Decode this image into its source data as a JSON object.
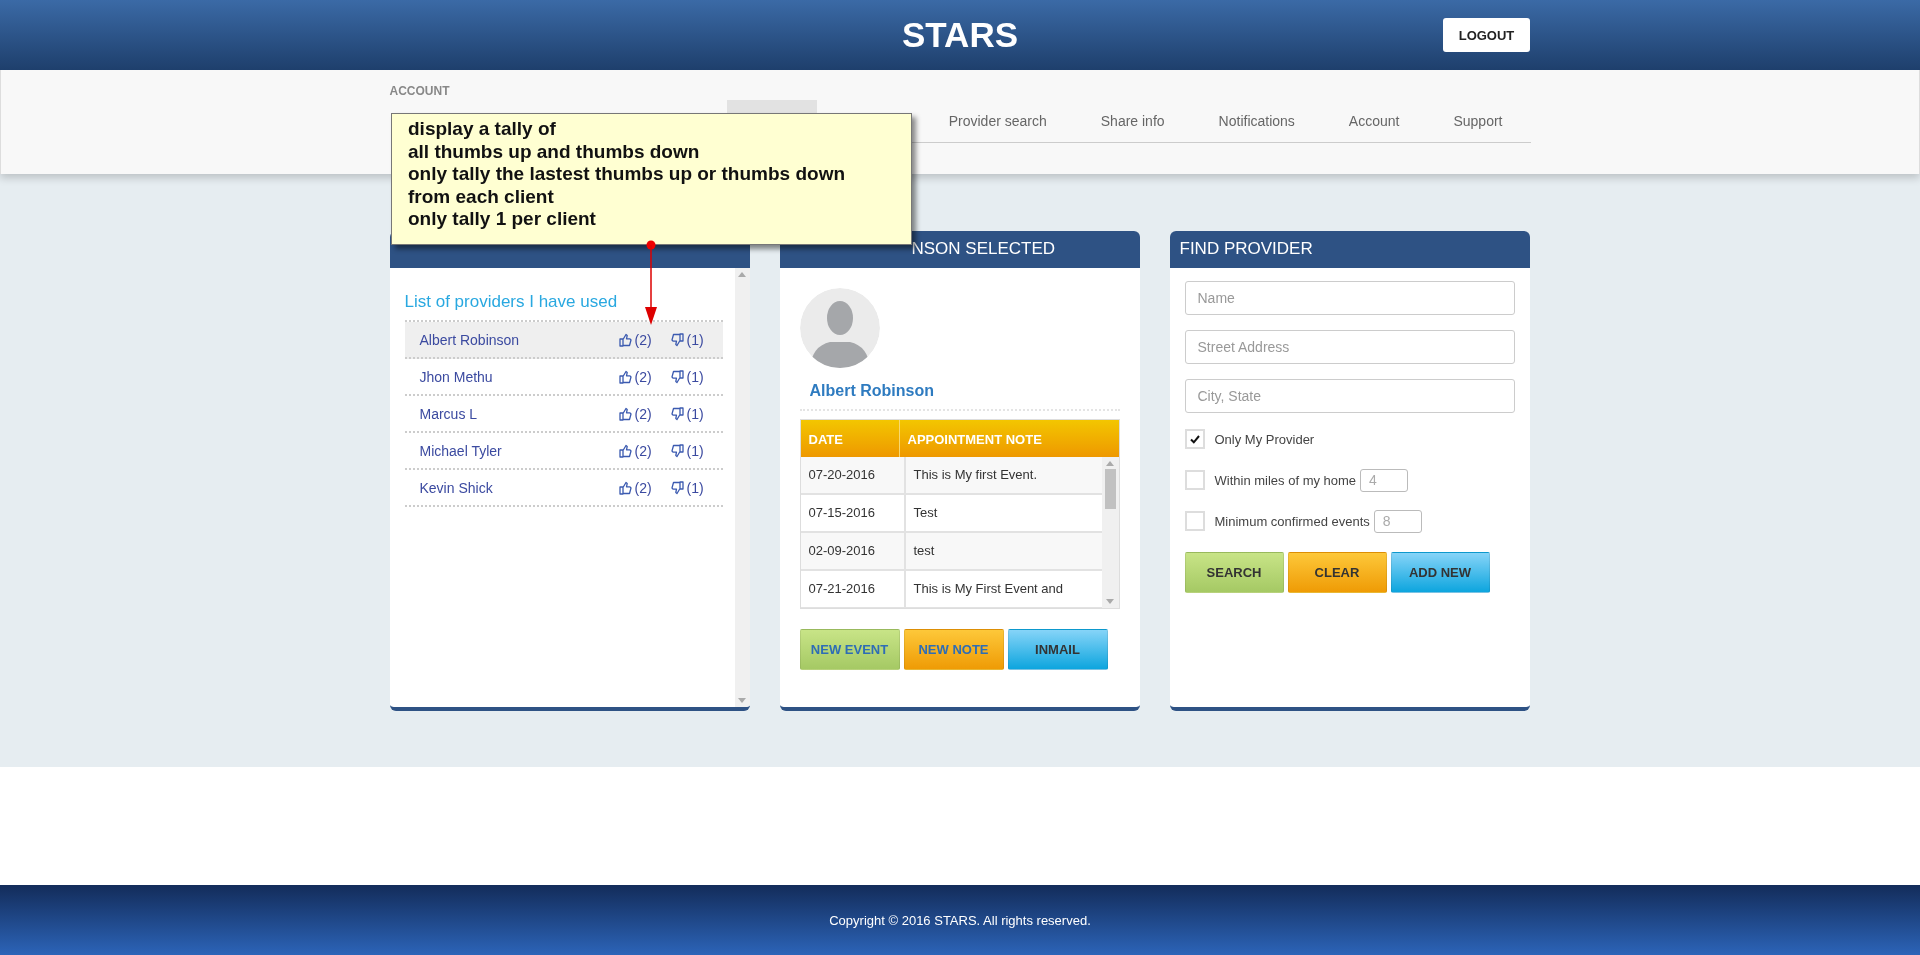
{
  "header": {
    "title": "STARS",
    "logout": "LOGOUT"
  },
  "account": {
    "label": "ACCOUNT"
  },
  "nav": {
    "items": [
      {
        "label": "Provider search",
        "selected": false
      },
      {
        "label": "Share info",
        "selected": false
      },
      {
        "label": "Notifications",
        "selected": false
      },
      {
        "label": "Account",
        "selected": false
      },
      {
        "label": "Support",
        "selected": false
      }
    ]
  },
  "annotation": {
    "lines": [
      "display a tally of",
      "all thumbs up and thumbs down",
      "only tally the lastest thumbs up or thumbs down",
      "from each client",
      "only tally 1 per client"
    ]
  },
  "results_panel": {
    "heading": "List of providers I have used",
    "providers": [
      {
        "name": "Albert Robinson",
        "thumbs_up": "(2)",
        "thumbs_down": "(1)",
        "selected": true
      },
      {
        "name": "Jhon Methu",
        "thumbs_up": "(2)",
        "thumbs_down": "(1)",
        "selected": false
      },
      {
        "name": "Marcus L",
        "thumbs_up": "(2)",
        "thumbs_down": "(1)",
        "selected": false
      },
      {
        "name": "Michael Tyler",
        "thumbs_up": "(2)",
        "thumbs_down": "(1)",
        "selected": false
      },
      {
        "name": "Kevin Shick",
        "thumbs_up": "(2)",
        "thumbs_down": "(1)",
        "selected": false
      }
    ]
  },
  "selected_panel": {
    "title": "NSON SELECTED",
    "name": "Albert Robinson",
    "columns": [
      "DATE",
      "APPOINTMENT NOTE"
    ],
    "rows": [
      [
        "07-20-2016",
        "This is My first Event."
      ],
      [
        "07-15-2016",
        "Test"
      ],
      [
        "02-09-2016",
        "test"
      ],
      [
        "07-21-2016",
        "This is My First Event and"
      ]
    ],
    "buttons": [
      {
        "label": "NEW EVENT",
        "kind": "green"
      },
      {
        "label": "NEW NOTE",
        "kind": "orange"
      },
      {
        "label": "INMAIL",
        "kind": "blue"
      }
    ]
  },
  "find_panel": {
    "title": "FIND PROVIDER",
    "fields": [
      {
        "placeholder": "Name"
      },
      {
        "placeholder": "Street Address"
      },
      {
        "placeholder": "City, State"
      }
    ],
    "options": [
      {
        "label": "Only My Provider",
        "checked": true
      },
      {
        "label": "Within miles of my home",
        "checked": false,
        "placeholder": "4"
      },
      {
        "label": "Minimum confirmed events",
        "checked": false,
        "placeholder": "8"
      }
    ],
    "buttons": [
      {
        "label": "SEARCH",
        "kind": "green"
      },
      {
        "label": "CLEAR",
        "kind": "orange"
      },
      {
        "label": "ADD NEW",
        "kind": "blue"
      }
    ]
  },
  "footer": {
    "text": "Copyright © 2016 STARS. All rights reserved."
  }
}
